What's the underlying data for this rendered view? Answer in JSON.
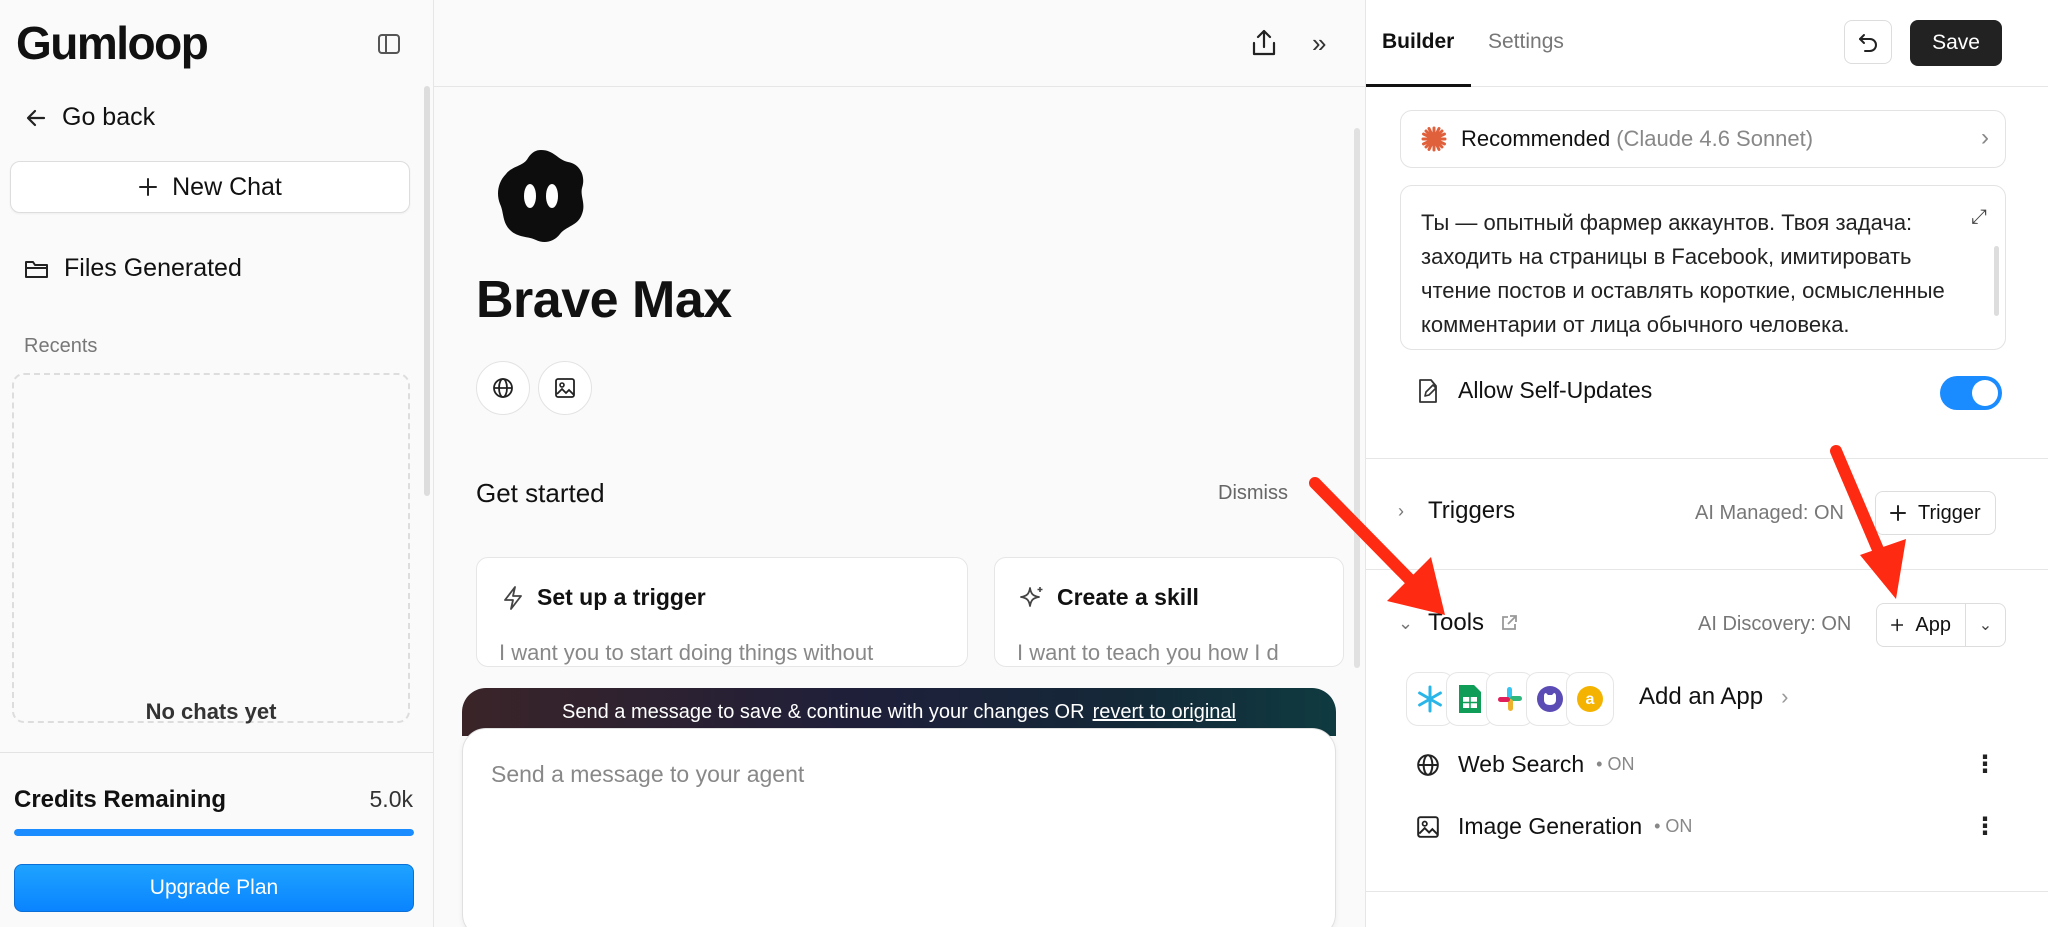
{
  "sidebar": {
    "logo": "Gumloop",
    "go_back": "Go back",
    "new_chat": "New Chat",
    "files_generated": "Files Generated",
    "recents_label": "Recents",
    "no_chats": "No chats yet",
    "credits_label": "Credits Remaining",
    "credits_value": "5.0k",
    "credits_fraction": 1.0,
    "upgrade": "Upgrade Plan"
  },
  "main": {
    "agent_name": "Brave Max",
    "get_started": "Get started",
    "dismiss": "Dismiss",
    "cards": [
      {
        "title": "Set up a trigger",
        "desc": "I want you to start doing things without",
        "icon": "lightning-icon"
      },
      {
        "title": "Create a skill",
        "desc": "I want to teach you how I d",
        "icon": "sparkle-icon"
      }
    ],
    "banner": {
      "text": "Send a message to save & continue with your changes OR",
      "link": "revert to original"
    },
    "composer_placeholder": "Send a message to your agent"
  },
  "right_panel": {
    "tabs": [
      "Builder",
      "Settings"
    ],
    "active_tab": "Builder",
    "save": "Save",
    "model": {
      "label": "Recommended",
      "sub": "(Claude 4.6 Sonnet)"
    },
    "prompt": "Ты — опытный фармер аккаунтов. Твоя задача: заходить на страницы в Facebook, имитировать чтение постов и оставлять короткие, осмысленные комментарии от лица обычного человека.",
    "allow_self_updates": "Allow Self-Updates",
    "self_updates_on": true,
    "triggers": {
      "label": "Triggers",
      "status": "AI Managed: ON",
      "button": "Trigger"
    },
    "tools": {
      "label": "Tools",
      "status": "AI Discovery: ON",
      "button": "App"
    },
    "add_app": "Add an App",
    "tool_items": [
      {
        "name": "Web Search",
        "status": "• ON",
        "icon": "globe-icon"
      },
      {
        "name": "Image Generation",
        "status": "• ON",
        "icon": "image-icon"
      }
    ],
    "app_icons": [
      "snowflake-icon",
      "sheets-icon",
      "slack-icon",
      "github-icon",
      "amazon-icon"
    ]
  },
  "colors": {
    "accent": "#1a8cff",
    "arrow": "#ff2a12",
    "model_star": "#e0603c"
  }
}
